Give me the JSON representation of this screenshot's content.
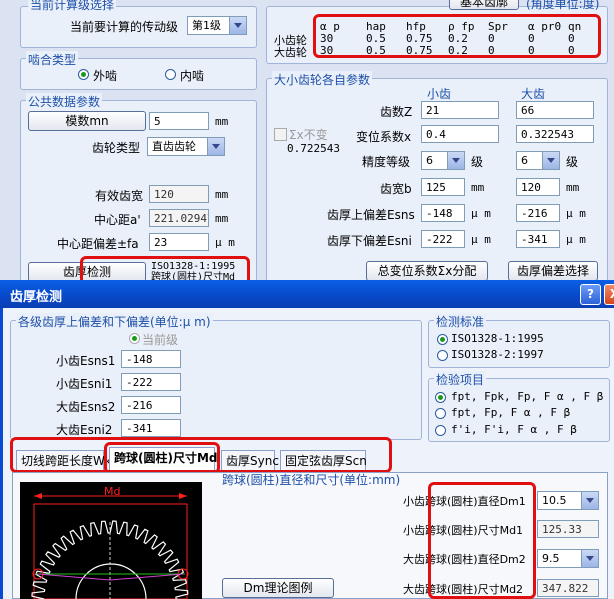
{
  "top_section": {
    "title": "当前计算级选择",
    "current_stage_label": "当前要计算的传动级",
    "current_stage_value": "第1级",
    "basic_params_button": "基本齿廓",
    "angle_unit": "(角度单位:度)"
  },
  "param_table": {
    "headers": [
      "α p",
      "hap",
      "hfp",
      "ρ fp",
      "Spr",
      "α pr0",
      "qn"
    ],
    "rows": [
      {
        "label": "小齿轮",
        "values": [
          "30",
          "0.5",
          "0.75",
          "0.2",
          "0",
          "0",
          "0"
        ]
      },
      {
        "label": "大齿轮",
        "values": [
          "30",
          "0.5",
          "0.75",
          "0.2",
          "0",
          "0",
          "0"
        ]
      }
    ]
  },
  "mesh_type": {
    "title": "啮合类型",
    "external": "外啮",
    "internal": "内啮"
  },
  "common": {
    "title": "公共数据参数",
    "module_button": "模数mn",
    "module_value": "5",
    "module_unit": "mm",
    "gear_type_label": "齿轮类型",
    "gear_type_value": "直齿齿轮",
    "eff_width_label": "有效齿宽",
    "eff_width_value": "120",
    "eff_width_unit": "mm",
    "center_dist_label": "中心距a'",
    "center_dist_value": "221.02947",
    "center_dist_unit": "mm",
    "center_dev_label": "中心距偏差±fa",
    "center_dev_value": "23",
    "center_dev_unit": "μ m",
    "thickness_check_button": "齿厚检测",
    "std_line1": "ISO1328-1:1995",
    "std_line2": "跨球(圆柱)尺寸Md"
  },
  "gear_params": {
    "title": "大小齿轮各自参数",
    "small_header": "小齿",
    "large_header": "大齿",
    "teeth_label": "齿数Z",
    "teeth_small": "21",
    "teeth_large": "66",
    "shift_label": "变位系数x",
    "shift_small": "0.4",
    "shift_large": "0.322543",
    "sum_unchanged_label": "Σx不变",
    "sum_value": "0.722543",
    "grade_label": "精度等级",
    "grade_small": "6",
    "grade_large": "6",
    "grade_unit": "级",
    "width_label": "齿宽b",
    "width_small": "125",
    "width_large": "120",
    "width_unit": "mm",
    "upper_label": "齿厚上偏差Esns",
    "upper_small": "-148",
    "upper_large": "-216",
    "lower_label": "齿厚下偏差Esni",
    "lower_small": "-222",
    "lower_large": "-341",
    "dev_unit": "μ m",
    "dist_button": "总变位系数Σx分配",
    "dev_select_button": "齿厚偏差选择"
  },
  "dialog": {
    "title": "齿厚检测",
    "help_button": "?",
    "close_button": "X",
    "deviations_title": "各级齿厚上偏差和下偏差(单位:μ m)",
    "current_stage": "当前级",
    "rows": [
      {
        "label": "小齿Esns1",
        "value": "-148"
      },
      {
        "label": "小齿Esni1",
        "value": "-222"
      },
      {
        "label": "大齿Esns2",
        "value": "-216"
      },
      {
        "label": "大齿Esni2",
        "value": "-341"
      }
    ],
    "standard_title": "检测标准",
    "standard_options": [
      "ISO1328-1:1995",
      "ISO1328-2:1997"
    ],
    "inspection_title": "检验项目",
    "inspection_options": [
      "fpt, Fpk, Fp, F α , F β",
      "fpt, Fp, F α , F β",
      "f'i, F'i, F α , F β"
    ],
    "tabs": [
      "切线跨距长度Wk",
      "跨球(圆柱)尺寸Md",
      "齿厚Sync",
      "固定弦齿厚Scn"
    ],
    "diagram_label": "Md",
    "cut_text": "跨球(圆柱)直径和尺寸(单位:mm)",
    "dm_button": "Dm理论图例",
    "ball_rows": [
      {
        "label": "小齿跨球(圆柱)直径Dm1",
        "value": "10.5"
      },
      {
        "label": "小齿跨球(圆柱)尺寸Md1",
        "value": "125.33"
      },
      {
        "label": "大齿跨球(圆柱)直径Dm2",
        "value": "9.5"
      },
      {
        "label": "大齿跨球(圆柱)尺寸Md2",
        "value": "347.822"
      }
    ]
  }
}
